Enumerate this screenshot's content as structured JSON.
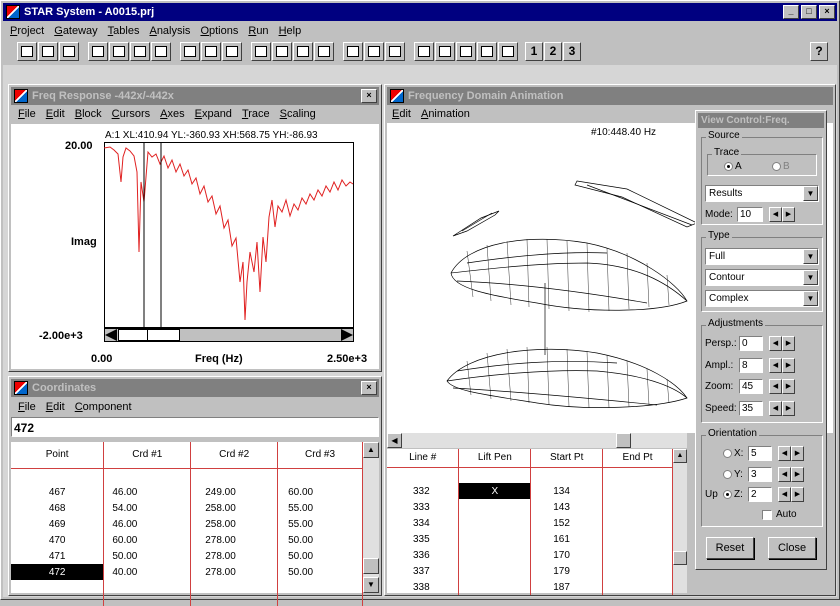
{
  "app": {
    "title": "STAR System - A0015.prj",
    "menu": [
      "Project",
      "Gateway",
      "Tables",
      "Analysis",
      "Options",
      "Run",
      "Help"
    ],
    "toolbar_numbers": [
      "1",
      "2",
      "3"
    ],
    "help_icon_label": "?"
  },
  "freq_window": {
    "title": "Freq Response -442x/-442x",
    "menu": [
      "File",
      "Edit",
      "Block",
      "Cursors",
      "Axes",
      "Expand",
      "Trace",
      "Scaling"
    ],
    "cursor_readout": "A:1 XL:410.94  YL:-360.93  XH:568.75  YH:-86.93",
    "y_top": "20.00",
    "y_label": "Imag",
    "y_bottom": "-2.00e+3",
    "x_left": "0.00",
    "x_label": "Freq (Hz)",
    "x_right": "2.50e+3"
  },
  "coords_window": {
    "title": "Coordinates",
    "menu": [
      "File",
      "Edit",
      "Component"
    ],
    "input_value": "472",
    "headers": [
      "Point",
      "Crd #1",
      "Crd #2",
      "Crd #3"
    ],
    "rows": [
      [
        "467",
        "46.00",
        "249.00",
        "60.00"
      ],
      [
        "468",
        "54.00",
        "258.00",
        "55.00"
      ],
      [
        "469",
        "46.00",
        "258.00",
        "55.00"
      ],
      [
        "470",
        "60.00",
        "278.00",
        "50.00"
      ],
      [
        "471",
        "50.00",
        "278.00",
        "50.00"
      ],
      [
        "472",
        "40.00",
        "278.00",
        "50.00"
      ]
    ]
  },
  "anim_window": {
    "title": "Frequency Domain Animation",
    "menu": [
      "Edit",
      "Animation"
    ],
    "freq_label": "#10:448.40 Hz"
  },
  "line_table": {
    "headers": [
      "Line #",
      "Lift Pen",
      "Start Pt",
      "End Pt"
    ],
    "rows": [
      [
        "332",
        "X",
        "134",
        ""
      ],
      [
        "333",
        "",
        "143",
        ""
      ],
      [
        "334",
        "",
        "152",
        ""
      ],
      [
        "335",
        "",
        "161",
        ""
      ],
      [
        "336",
        "",
        "170",
        ""
      ],
      [
        "337",
        "",
        "179",
        ""
      ],
      [
        "338",
        "",
        "187",
        ""
      ]
    ]
  },
  "view_control": {
    "title": "View Control:Freq.",
    "source_label": "Source",
    "trace_label": "Trace",
    "trace_a": "A",
    "trace_b": "B",
    "results": "Results",
    "mode_label": "Mode:",
    "mode_value": "10",
    "type_label": "Type",
    "type_options": [
      "Full",
      "Contour",
      "Complex"
    ],
    "adjust_label": "Adjustments",
    "persp_label": "Persp.:",
    "persp_value": "0",
    "ampl_label": "Ampl.:",
    "ampl_value": "8",
    "zoom_label": "Zoom:",
    "zoom_value": "45",
    "speed_label": "Speed:",
    "speed_value": "35",
    "orient_label": "Orientation",
    "x_label": "X:",
    "x_value": "5",
    "y_label": "Y:",
    "y_value": "3",
    "up_label": "Up",
    "z_label": "Z:",
    "z_value": "2",
    "auto_label": "Auto",
    "reset_label": "Reset",
    "close_label": "Close"
  }
}
